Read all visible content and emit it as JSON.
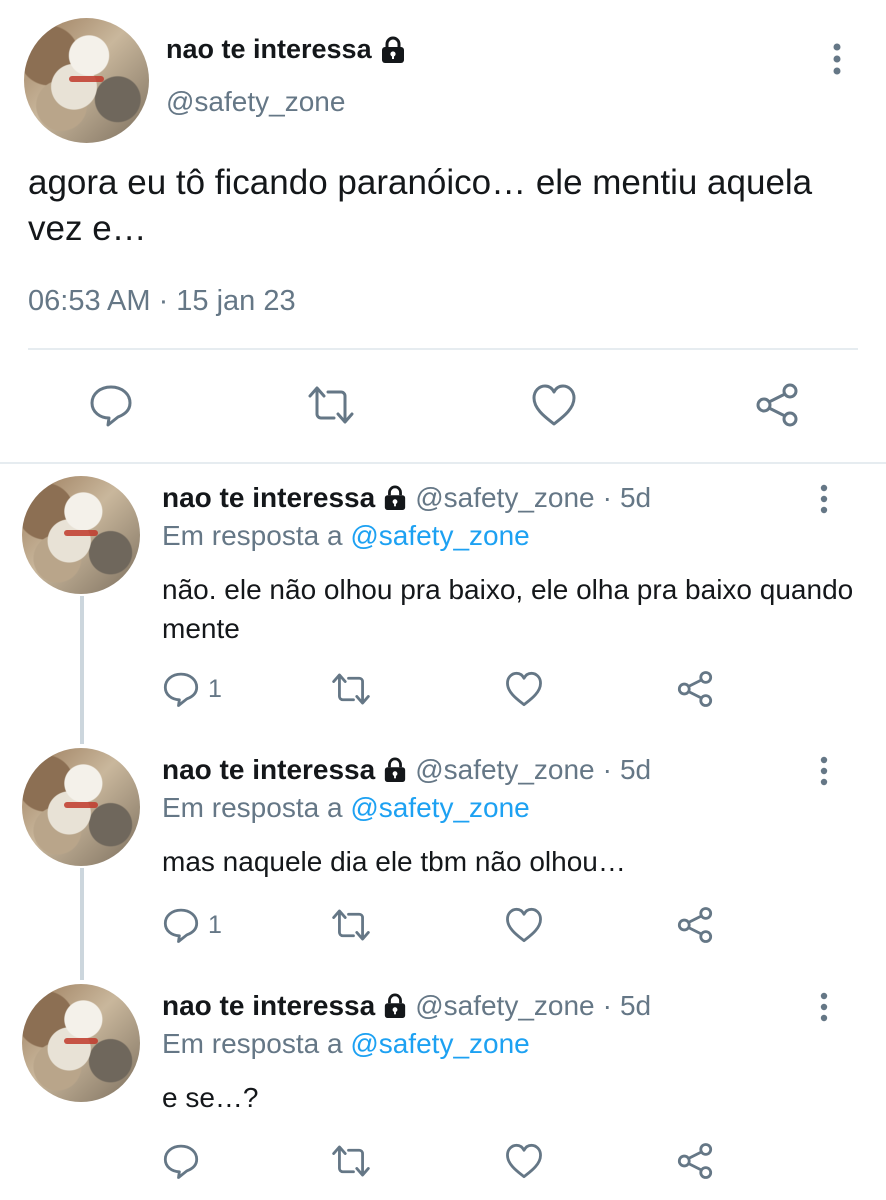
{
  "main_tweet": {
    "author_name": "nao te interessa",
    "handle": "@safety_zone",
    "text": "agora eu tô ficando paranóico… ele mentiu aquela vez e…",
    "timestamp": "06:53 AM · 15 jan 23",
    "icons": [
      "lock-icon",
      "more-vertical-icon",
      "reply-icon",
      "retweet-icon",
      "like-icon",
      "share-icon"
    ]
  },
  "replies": [
    {
      "author_name": "nao te interessa",
      "handle": "@safety_zone",
      "separator": "·",
      "age": "5d",
      "reply_to_prefix": "Em resposta a",
      "reply_to_handle": "@safety_zone",
      "text": "não. ele não olhou pra baixo, ele olha pra baixo quando mente",
      "reply_count": "1"
    },
    {
      "author_name": "nao te interessa",
      "handle": "@safety_zone",
      "separator": "·",
      "age": "5d",
      "reply_to_prefix": "Em resposta a",
      "reply_to_handle": "@safety_zone",
      "text": "mas naquele dia ele tbm não olhou…",
      "reply_count": "1"
    },
    {
      "author_name": "nao te interessa",
      "handle": "@safety_zone",
      "separator": "·",
      "age": "5d",
      "reply_to_prefix": "Em resposta a",
      "reply_to_handle": "@safety_zone",
      "text": "e se…?",
      "reply_count": ""
    }
  ],
  "colors": {
    "text": "#14171a",
    "secondary": "#657786",
    "link": "#1da1f2",
    "divider": "#e6ecf0",
    "thread_line": "#ccd6dd"
  }
}
